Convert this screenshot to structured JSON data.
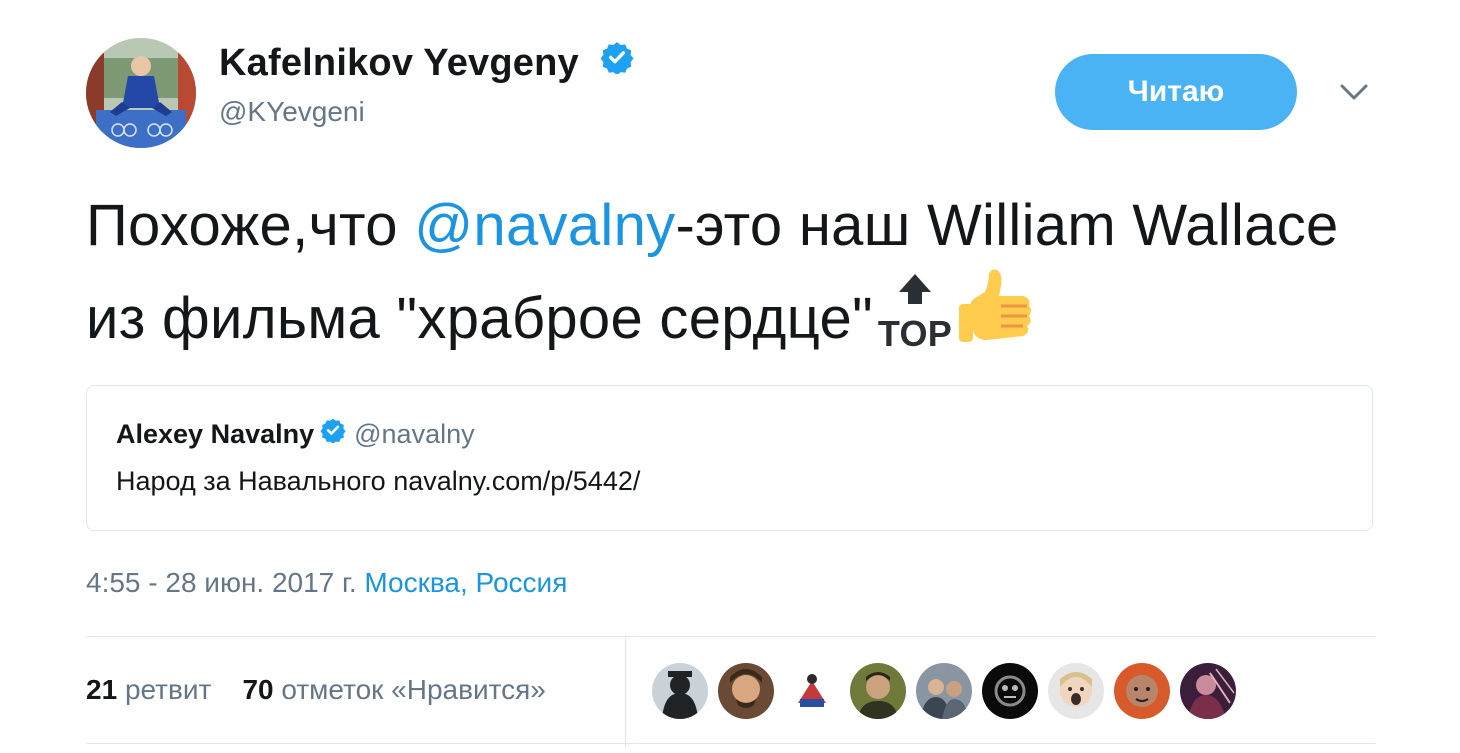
{
  "author": {
    "name": "Kafelnikov Yevgeny",
    "handle": "@KYevgeni",
    "verified": true
  },
  "follow_button_label": "Читаю",
  "tweet": {
    "text_before": "Похоже,что ",
    "mention": "@navalny",
    "text_after": "-это наш William Wallace из фильма \"храброе сердце\"",
    "emojis": [
      "top-arrow-emoji",
      "thumbs-up-emoji"
    ],
    "timestamp": "4:55 - 28 июн. 2017 г.",
    "location": "Москва, Россия"
  },
  "quoted_tweet": {
    "author_name": "Alexey Navalny",
    "author_handle": "@navalny",
    "verified": true,
    "text": "Народ за Навального navalny.com/p/5442/"
  },
  "stats": {
    "retweets_count": "21",
    "retweets_label": "ретвит",
    "likes_count": "70",
    "likes_label": "отметок «Нравится»"
  },
  "liker_count_shown": 9,
  "colors": {
    "accent": "#1b95e0",
    "button": "#4ab3f4",
    "secondary_text": "#657786",
    "border": "#e1e8ed"
  }
}
